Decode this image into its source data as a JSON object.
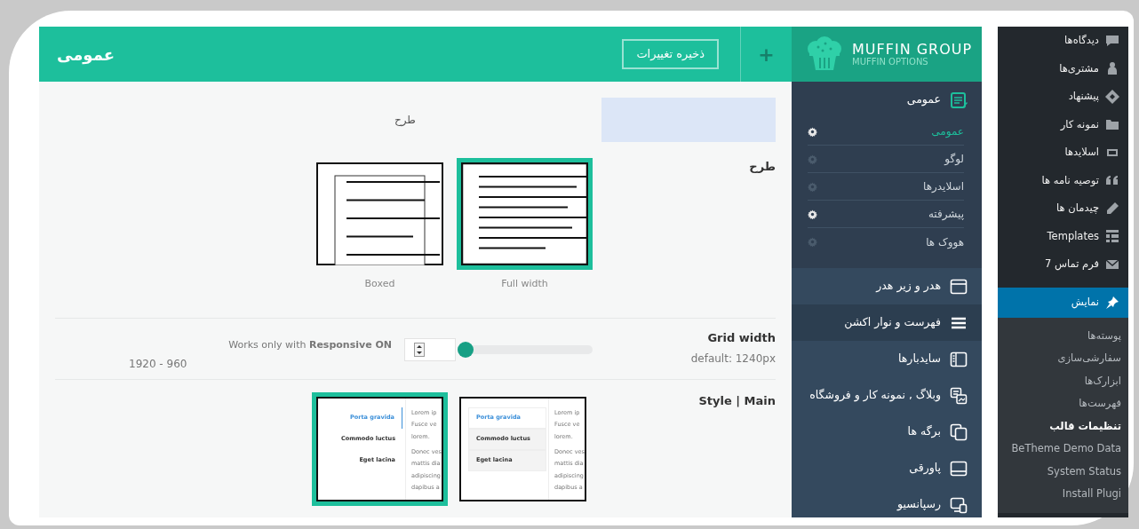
{
  "header": {
    "title": "عمومی",
    "save_button": "ذخیره تغییرات",
    "add_button": "+"
  },
  "intro": {
    "text": "طرح"
  },
  "layout": {
    "label": "طرح",
    "options": [
      {
        "caption": "Full width",
        "kind": "full",
        "selected": true
      },
      {
        "caption": "Boxed",
        "kind": "boxed",
        "selected": false
      }
    ]
  },
  "grid_width": {
    "label": "Grid width",
    "default": "default: 1240px",
    "note": "Works only with **Responsive ON**",
    "level": 0,
    "range": "1920 - 960"
  },
  "style": {
    "label": "Style | Main",
    "options": [
      {
        "kind": "default",
        "selected": false,
        "tabs": [
          "Porta gravida",
          "Commodo luctus",
          "Eget lacina"
        ],
        "text": [
          "Lorem ip",
          "Fusce ve",
          "lorem.",
          "Donec ves",
          "mattis dia",
          "adipiscing",
          "dapibus a"
        ]
      },
      {
        "kind": "simple",
        "selected": true,
        "tabs": [
          "Porta gravida",
          "Commodo luctus",
          "Eget lacina"
        ],
        "text": [
          "Lorem ip",
          "Fusce ve",
          "lorem.",
          "Donec ves",
          "mattis dia",
          "adipiscing",
          "dapibus a"
        ]
      }
    ]
  },
  "options_sidebar": {
    "logo": {
      "title": "MUFFIN GROUP",
      "subtitle": "MUFFIN OPTIONS"
    },
    "groups": [
      {
        "label": "عمومی",
        "expanded": true,
        "hovered": false,
        "children": [
          {
            "label": "عمومی",
            "selected": true,
            "on": true
          },
          {
            "label": "لوگو",
            "selected": false,
            "on": false
          },
          {
            "label": "اسلایدرها",
            "selected": false,
            "on": false
          },
          {
            "label": "پیشرفته",
            "selected": false,
            "on": true
          },
          {
            "label": "هووک ها",
            "selected": false,
            "on": false
          }
        ]
      },
      {
        "label": "هدر و زیر هدر",
        "expanded": false,
        "hovered": false
      },
      {
        "label": "فهرست و نوار اکشن",
        "expanded": false,
        "hovered": true
      },
      {
        "label": "سایدبارها",
        "expanded": false,
        "hovered": false
      },
      {
        "label": "وبلاگ , نمونه کار و فروشگاه",
        "expanded": false,
        "hovered": false
      },
      {
        "label": "برگه ها",
        "expanded": false,
        "hovered": false
      },
      {
        "label": "پاورقی",
        "expanded": false,
        "hovered": false
      },
      {
        "label": "رسپانسیو",
        "expanded": false,
        "hovered": false
      }
    ]
  },
  "wp_menu": {
    "items": [
      {
        "label": "دیدگاه‌ها",
        "selected": false
      },
      {
        "label": "مشتری‌ها",
        "selected": false
      },
      {
        "label": "پیشنهاد",
        "selected": false
      },
      {
        "label": "نمونه کار",
        "selected": false
      },
      {
        "label": "اسلایدها",
        "selected": false
      },
      {
        "label": "توصیه نامه ها",
        "selected": false
      },
      {
        "label": "چیدمان ها",
        "selected": false
      },
      {
        "label": "Templates",
        "selected": false
      },
      {
        "label": "فرم تماس 7",
        "selected": false
      },
      {
        "label": "نمایش",
        "selected": true
      }
    ],
    "submenu": [
      {
        "label": "پوسته‌ها",
        "selected": false
      },
      {
        "label": "سفارشی‌سازی",
        "selected": false
      },
      {
        "label": "ابزارک‌ها",
        "selected": false
      },
      {
        "label": "فهرست‌ها",
        "selected": false
      },
      {
        "label": "تنظیمات قالب",
        "selected": true
      },
      {
        "label": "BeTheme Demo Data",
        "selected": false
      },
      {
        "label": "System Status",
        "selected": false
      },
      {
        "label": "Install Plugi",
        "selected": false
      }
    ]
  }
}
